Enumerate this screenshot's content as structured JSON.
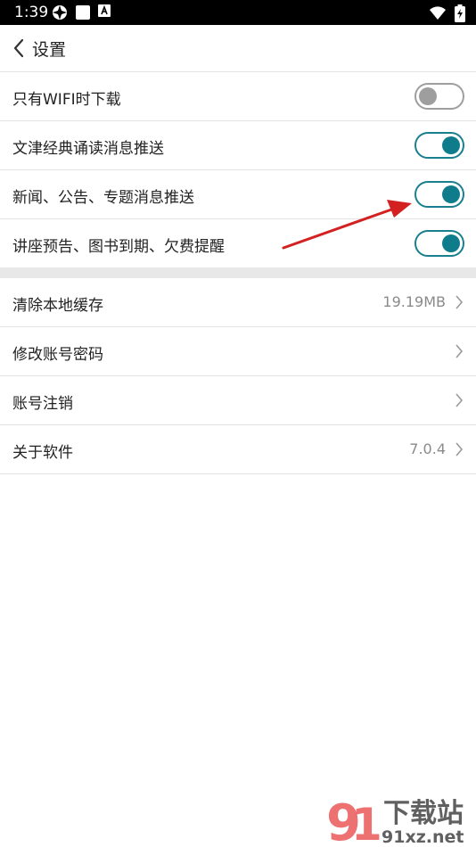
{
  "status_bar": {
    "time": "1:39"
  },
  "header": {
    "title": "设置"
  },
  "toggles": [
    {
      "label": "只有WIFI时下载",
      "on": false
    },
    {
      "label": "文津经典诵读消息推送",
      "on": true
    },
    {
      "label": "新闻、公告、专题消息推送",
      "on": true
    },
    {
      "label": "讲座预告、图书到期、欠费提醒",
      "on": true
    }
  ],
  "settings": [
    {
      "label": "清除本地缓存",
      "value": "19.19MB"
    },
    {
      "label": "修改账号密码",
      "value": ""
    },
    {
      "label": "账号注销",
      "value": ""
    },
    {
      "label": "关于软件",
      "value": "7.0.4"
    }
  ],
  "colors": {
    "accent": "#0f7c8c",
    "arrow": "#d32020"
  },
  "watermark": {
    "text": "下载站",
    "domain": "91xz.net"
  }
}
